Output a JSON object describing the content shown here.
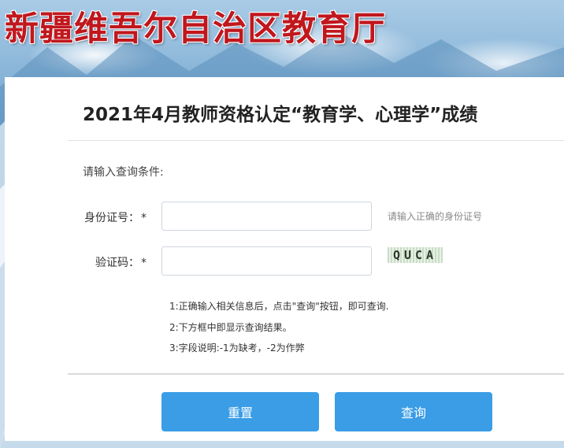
{
  "header": {
    "banner_title": "新疆维吾尔自治区教育厅"
  },
  "page": {
    "title": "2021年4月教师资格认定“教育学、心理学”成绩",
    "prompt": "请输入查询条件:"
  },
  "form": {
    "id_label": "身份证号：",
    "id_required": "*",
    "id_value": "",
    "id_hint": "请输入正确的身份证号",
    "captcha_label": "验证码：",
    "captcha_required": "*",
    "captcha_value": "",
    "captcha_text": "QUCA"
  },
  "notes": [
    "1:正确输入相关信息后，点击\"查询\"按钮，即可查询.",
    "2:下方框中即显示查询结果。",
    "3:字段说明:-1为缺考，-2为作弊"
  ],
  "buttons": {
    "reset_label": "重置",
    "query_label": "查询"
  },
  "colors": {
    "accent": "#3a9de6",
    "banner_text": "#c0171d"
  }
}
